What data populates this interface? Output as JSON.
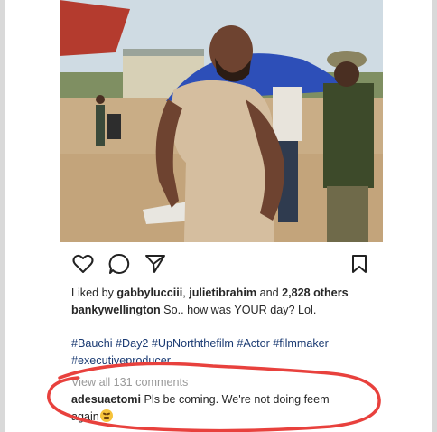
{
  "post": {
    "liked_prefix": "Liked by ",
    "liked_user1": "gabbylucciii",
    "liked_sep": ", ",
    "liked_user2": "julietibrahim",
    "liked_and": " and ",
    "liked_count": "2,828 others",
    "author": "bankywellington",
    "caption": " So.. how was YOUR day? Lol.",
    "hashtags_line1": "#Bauchi #Day2 #UpNorththefilm #Actor #filmmaker",
    "hashtags_line2": "#executiveproducer",
    "view_comments": "View all 131 comments",
    "comment_author": "adesuaetomi",
    "comment_text_line1": " Pls be coming. We're not doing feem",
    "comment_text_line2": "again"
  },
  "icons": {
    "like": "heart-icon",
    "comment": "comment-bubble-icon",
    "share": "paper-plane-icon",
    "save": "bookmark-icon"
  },
  "colors": {
    "annotation": "#e8413d",
    "hashtag": "#1a3a72",
    "muted": "#9a9a9a"
  }
}
